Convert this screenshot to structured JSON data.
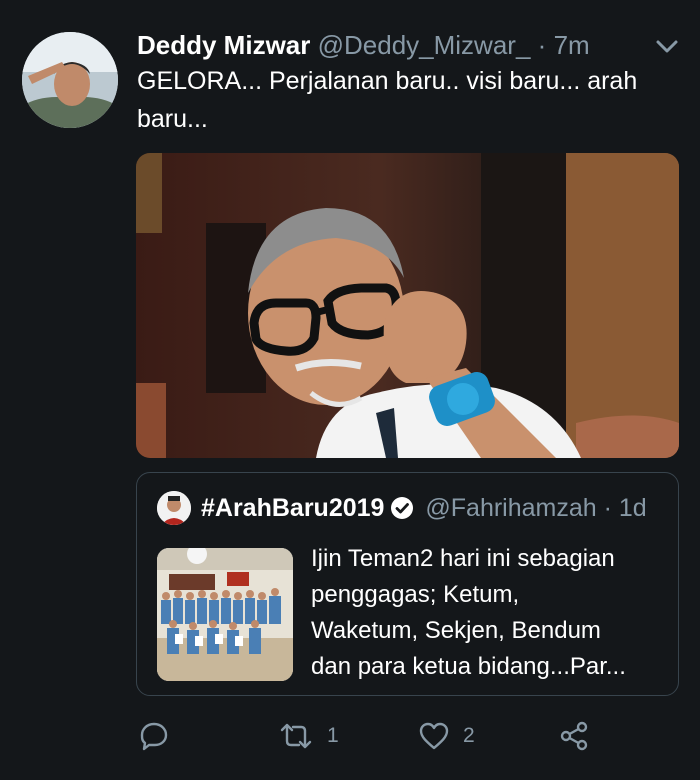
{
  "tweet": {
    "name": "Deddy Mizwar",
    "handle": "@Deddy_Mizwar_",
    "dot": "·",
    "time": "7m",
    "text": "GELORA... Perjalanan baru.. visi baru... arah baru...",
    "quote": {
      "name": "#ArahBaru2019",
      "handle": "@Fahrihamzah",
      "dot": "·",
      "time": "1d",
      "text_lines": [
        "Ijin Teman2 hari ini sebagian",
        "penggagas; Ketum,",
        "Waketum, Sekjen, Bendum",
        "dan para ketua bidang...Par..."
      ]
    },
    "actions": {
      "reply_icon": "reply-icon",
      "retweet_icon": "retweet-icon",
      "retweet_count": "1",
      "like_icon": "heart-icon",
      "like_count": "2",
      "share_icon": "share-icon"
    }
  },
  "colors": {
    "background": "#14171a",
    "text": "#ffffff",
    "muted": "#8899a6",
    "border": "#38444d"
  }
}
